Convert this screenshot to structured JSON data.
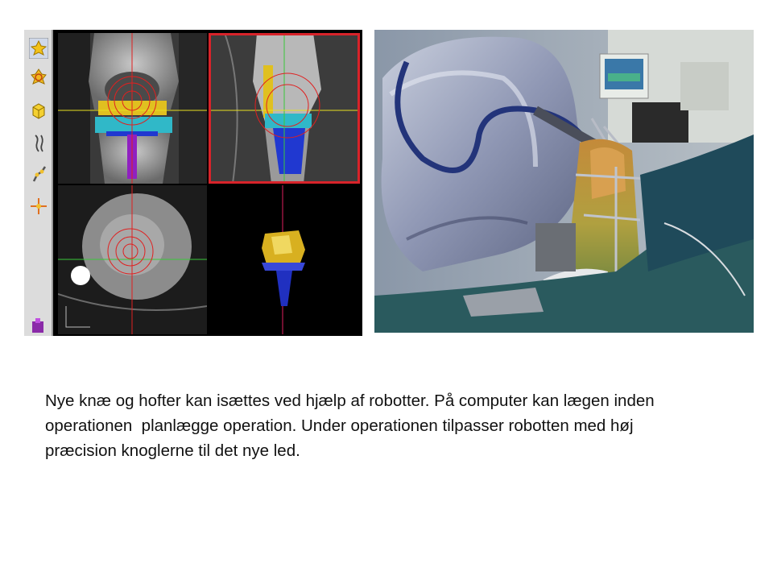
{
  "caption": {
    "line1": "Nye knæ og hofter kan isættes ved hjælp af robotter. På computer kan lægen inden",
    "line2": "operationen  planlægge operation. Under operationen tilpasser robotten med høj",
    "line3": "præcision knoglerne til det nye led."
  },
  "colors": {
    "background": "#ffffff",
    "toolbar": "#dcdcdc",
    "active_pane_border": "#d8232a",
    "crosshair_red": "#e02020",
    "crosshair_yellow": "#e8e020",
    "crosshair_green": "#3ac83a",
    "implant_yellow": "#e0c020",
    "implant_cyan": "#30b8c8",
    "implant_blue": "#2038d0",
    "implant_purple": "#9020c0"
  },
  "icons": [
    "select-icon",
    "rotate-icon",
    "cube-icon",
    "bone-icon",
    "robot-arm-icon",
    "crosshair-icon",
    "exit-icon"
  ]
}
